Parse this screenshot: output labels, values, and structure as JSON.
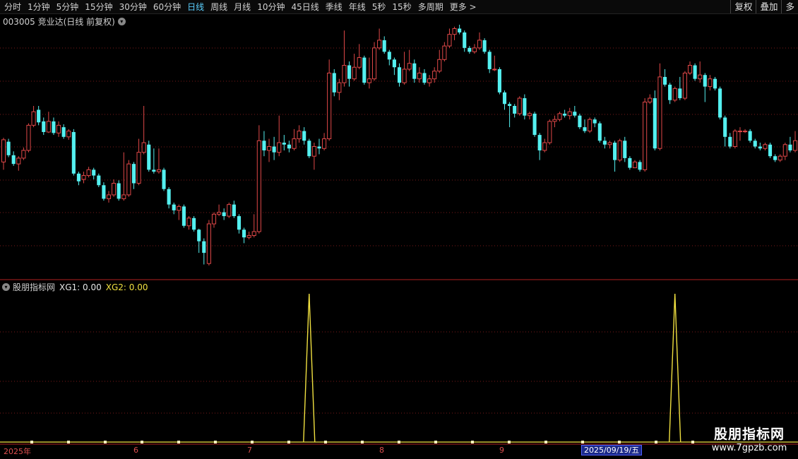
{
  "toolbar": {
    "periods": [
      "分时",
      "1分钟",
      "5分钟",
      "15分钟",
      "30分钟",
      "60分钟",
      "日线",
      "周线",
      "月线",
      "10分钟",
      "45日线",
      "季线",
      "年线",
      "5秒",
      "15秒",
      "多周期",
      "更多 >"
    ],
    "active": "日线",
    "right_buttons": [
      "复权",
      "叠加",
      "多"
    ]
  },
  "main_panel": {
    "title": "003005 竞业达(日线 前复权)"
  },
  "indicator_panel": {
    "name": "股朋指标网",
    "xg1_label": "XG1:",
    "xg1_value": "0.00",
    "xg2_label": "XG2:",
    "xg2_value": "0.00"
  },
  "date_axis": {
    "labels": [
      "2025年",
      "6",
      "7",
      "8",
      "9"
    ],
    "selected_date": "2025/09/19/五"
  },
  "watermark": {
    "title": "股朋指标网",
    "url": "www.7gpzb.com"
  },
  "colors": {
    "up": "#e04848",
    "down": "#54f0f0",
    "signal": "#f0e040",
    "grid": "#7a1a1a"
  },
  "chart_data": {
    "type": "candlestick",
    "candles": [
      [
        0.47,
        0.585,
        0.595,
        0.43
      ],
      [
        0.575,
        0.505,
        0.59,
        0.495
      ],
      [
        0.505,
        0.46,
        0.525,
        0.45
      ],
      [
        0.46,
        0.49,
        0.5,
        0.425
      ],
      [
        0.49,
        0.53,
        0.545,
        0.48
      ],
      [
        0.53,
        0.66,
        0.67,
        0.52
      ],
      [
        0.66,
        0.73,
        0.76,
        0.65
      ],
      [
        0.74,
        0.675,
        0.76,
        0.66
      ],
      [
        0.68,
        0.625,
        0.7,
        0.61
      ],
      [
        0.625,
        0.68,
        0.73,
        0.62
      ],
      [
        0.68,
        0.62,
        0.7,
        0.61
      ],
      [
        0.62,
        0.66,
        0.68,
        0.6
      ],
      [
        0.65,
        0.6,
        0.665,
        0.59
      ],
      [
        0.6,
        0.63,
        0.64,
        0.585
      ],
      [
        0.625,
        0.41,
        0.64,
        0.4
      ],
      [
        0.41,
        0.37,
        0.42,
        0.35
      ],
      [
        0.38,
        0.4,
        0.42,
        0.36
      ],
      [
        0.4,
        0.43,
        0.445,
        0.39
      ],
      [
        0.43,
        0.4,
        0.44,
        0.38
      ],
      [
        0.4,
        0.35,
        0.41,
        0.34
      ],
      [
        0.35,
        0.28,
        0.365,
        0.27
      ],
      [
        0.28,
        0.3,
        0.32,
        0.26
      ],
      [
        0.3,
        0.36,
        0.38,
        0.29
      ],
      [
        0.36,
        0.28,
        0.375,
        0.27
      ],
      [
        0.28,
        0.3,
        0.52,
        0.27
      ],
      [
        0.3,
        0.46,
        0.48,
        0.29
      ],
      [
        0.46,
        0.36,
        0.47,
        0.33
      ],
      [
        0.36,
        0.52,
        0.59,
        0.35
      ],
      [
        0.52,
        0.57,
        0.76,
        0.51
      ],
      [
        0.56,
        0.43,
        0.58,
        0.42
      ],
      [
        0.43,
        0.42,
        0.54,
        0.41
      ],
      [
        0.42,
        0.43,
        0.54,
        0.41
      ],
      [
        0.43,
        0.33,
        0.44,
        0.32
      ],
      [
        0.33,
        0.25,
        0.34,
        0.23
      ],
      [
        0.25,
        0.22,
        0.26,
        0.2
      ],
      [
        0.22,
        0.24,
        0.25,
        0.17
      ],
      [
        0.24,
        0.14,
        0.25,
        0.13
      ],
      [
        0.14,
        0.18,
        0.19,
        0.12
      ],
      [
        0.18,
        0.12,
        0.19,
        0.11
      ],
      [
        0.12,
        0.06,
        0.125,
        0.0
      ],
      [
        0.06,
        0.0,
        0.075,
        -0.06
      ],
      [
        -0.055,
        0.15,
        0.17,
        -0.065
      ],
      [
        0.15,
        0.2,
        0.21,
        0.13
      ],
      [
        0.2,
        0.21,
        0.25,
        0.19
      ],
      [
        0.21,
        0.19,
        0.23,
        0.17
      ],
      [
        0.19,
        0.25,
        0.26,
        0.18
      ],
      [
        0.25,
        0.19,
        0.27,
        0.18
      ],
      [
        0.19,
        0.12,
        0.2,
        0.1
      ],
      [
        0.12,
        0.08,
        0.13,
        0.05
      ],
      [
        0.08,
        0.09,
        0.11,
        0.07
      ],
      [
        0.09,
        0.11,
        0.2,
        0.08
      ],
      [
        0.11,
        0.58,
        0.66,
        0.1
      ],
      [
        0.58,
        0.53,
        0.63,
        0.5
      ],
      [
        0.53,
        0.55,
        0.59,
        0.47
      ],
      [
        0.55,
        0.52,
        0.6,
        0.48
      ],
      [
        0.52,
        0.57,
        0.71,
        0.5
      ],
      [
        0.57,
        0.56,
        0.61,
        0.53
      ],
      [
        0.56,
        0.54,
        0.58,
        0.52
      ],
      [
        0.54,
        0.59,
        0.64,
        0.53
      ],
      [
        0.59,
        0.63,
        0.66,
        0.57
      ],
      [
        0.63,
        0.58,
        0.65,
        0.56
      ],
      [
        0.58,
        0.5,
        0.59,
        0.49
      ],
      [
        0.5,
        0.55,
        0.57,
        0.43
      ],
      [
        0.55,
        0.54,
        0.59,
        0.51
      ],
      [
        0.54,
        0.59,
        0.62,
        0.53
      ],
      [
        0.59,
        0.93,
        1.0,
        0.58
      ],
      [
        0.93,
        0.83,
        0.95,
        0.81
      ],
      [
        0.83,
        0.88,
        0.9,
        0.79
      ],
      [
        0.88,
        0.97,
        1.15,
        0.86
      ],
      [
        0.97,
        0.9,
        0.99,
        0.86
      ],
      [
        0.9,
        0.96,
        1.03,
        0.89
      ],
      [
        0.96,
        1.01,
        1.08,
        0.95
      ],
      [
        1.01,
        0.88,
        1.02,
        0.87
      ],
      [
        0.88,
        0.9,
        1.01,
        0.85
      ],
      [
        0.9,
        1.06,
        1.09,
        0.89
      ],
      [
        1.06,
        1.1,
        1.16,
        1.05
      ],
      [
        1.1,
        1.04,
        1.12,
        1.03
      ],
      [
        1.04,
        1.0,
        1.05,
        0.97
      ],
      [
        1.0,
        0.96,
        1.01,
        0.92
      ],
      [
        0.96,
        0.88,
        0.98,
        0.86
      ],
      [
        0.88,
        0.95,
        1.04,
        0.87
      ],
      [
        0.95,
        0.98,
        1.05,
        0.94
      ],
      [
        0.98,
        0.9,
        1.0,
        0.88
      ],
      [
        0.9,
        0.93,
        0.96,
        0.88
      ],
      [
        0.93,
        0.88,
        0.95,
        0.87
      ],
      [
        0.88,
        0.9,
        0.92,
        0.86
      ],
      [
        0.9,
        0.94,
        0.96,
        0.88
      ],
      [
        0.94,
        1.0,
        1.05,
        0.93
      ],
      [
        1.0,
        1.07,
        1.09,
        0.99
      ],
      [
        1.07,
        1.13,
        1.16,
        1.06
      ],
      [
        1.13,
        1.16,
        1.17,
        1.1
      ],
      [
        1.16,
        1.14,
        1.18,
        1.13
      ],
      [
        1.14,
        1.06,
        1.15,
        1.04
      ],
      [
        1.06,
        1.04,
        1.07,
        1.03
      ],
      [
        1.04,
        1.06,
        1.08,
        1.03
      ],
      [
        1.06,
        1.1,
        1.14,
        1.05
      ],
      [
        1.1,
        1.04,
        1.11,
        1.03
      ],
      [
        1.04,
        0.95,
        1.05,
        0.93
      ],
      [
        0.95,
        0.95,
        1.02,
        0.94
      ],
      [
        0.95,
        0.83,
        0.96,
        0.82
      ],
      [
        0.83,
        0.77,
        0.84,
        0.74
      ],
      [
        0.77,
        0.76,
        0.78,
        0.65
      ],
      [
        0.76,
        0.72,
        0.77,
        0.7
      ],
      [
        0.72,
        0.8,
        0.81,
        0.71
      ],
      [
        0.8,
        0.71,
        0.82,
        0.69
      ],
      [
        0.71,
        0.72,
        0.73,
        0.69
      ],
      [
        0.72,
        0.61,
        0.73,
        0.6
      ],
      [
        0.61,
        0.53,
        0.62,
        0.48
      ],
      [
        0.53,
        0.57,
        0.59,
        0.52
      ],
      [
        0.57,
        0.68,
        0.69,
        0.56
      ],
      [
        0.68,
        0.69,
        0.71,
        0.65
      ],
      [
        0.69,
        0.72,
        0.73,
        0.68
      ],
      [
        0.72,
        0.71,
        0.74,
        0.7
      ],
      [
        0.71,
        0.73,
        0.75,
        0.69
      ],
      [
        0.73,
        0.71,
        0.76,
        0.7
      ],
      [
        0.71,
        0.65,
        0.72,
        0.64
      ],
      [
        0.65,
        0.63,
        0.69,
        0.62
      ],
      [
        0.63,
        0.69,
        0.7,
        0.62
      ],
      [
        0.69,
        0.67,
        0.7,
        0.65
      ],
      [
        0.67,
        0.58,
        0.68,
        0.57
      ],
      [
        0.58,
        0.56,
        0.6,
        0.54
      ],
      [
        0.56,
        0.57,
        0.58,
        0.54
      ],
      [
        0.57,
        0.48,
        0.58,
        0.42
      ],
      [
        0.48,
        0.58,
        0.59,
        0.47
      ],
      [
        0.58,
        0.49,
        0.6,
        0.47
      ],
      [
        0.49,
        0.44,
        0.5,
        0.43
      ],
      [
        0.44,
        0.47,
        0.48,
        0.44
      ],
      [
        0.47,
        0.43,
        0.48,
        0.42
      ],
      [
        0.43,
        0.78,
        0.8,
        0.42
      ],
      [
        0.78,
        0.8,
        0.82,
        0.77
      ],
      [
        0.8,
        0.54,
        0.84,
        0.53
      ],
      [
        0.54,
        0.91,
        0.98,
        0.53
      ],
      [
        0.91,
        0.87,
        0.95,
        0.86
      ],
      [
        0.87,
        0.79,
        0.88,
        0.77
      ],
      [
        0.79,
        0.85,
        0.86,
        0.78
      ],
      [
        0.85,
        0.8,
        0.91,
        0.79
      ],
      [
        0.8,
        0.93,
        0.94,
        0.79
      ],
      [
        0.93,
        0.97,
        0.99,
        0.92
      ],
      [
        0.97,
        0.9,
        0.98,
        0.89
      ],
      [
        0.9,
        0.92,
        0.99,
        0.88
      ],
      [
        0.92,
        0.86,
        0.93,
        0.78
      ],
      [
        0.86,
        0.9,
        0.92,
        0.84
      ],
      [
        0.9,
        0.85,
        0.91,
        0.84
      ],
      [
        0.85,
        0.7,
        0.86,
        0.69
      ],
      [
        0.7,
        0.6,
        0.71,
        0.55
      ],
      [
        0.6,
        0.55,
        0.62,
        0.54
      ],
      [
        0.55,
        0.63,
        0.64,
        0.54
      ],
      [
        0.63,
        0.63,
        0.65,
        0.58
      ],
      [
        0.63,
        0.63,
        0.64,
        0.62
      ],
      [
        0.63,
        0.58,
        0.64,
        0.57
      ],
      [
        0.58,
        0.55,
        0.59,
        0.54
      ],
      [
        0.55,
        0.54,
        0.57,
        0.53
      ],
      [
        0.54,
        0.56,
        0.57,
        0.53
      ],
      [
        0.56,
        0.5,
        0.57,
        0.49
      ],
      [
        0.5,
        0.48,
        0.51,
        0.47
      ],
      [
        0.48,
        0.5,
        0.51,
        0.47
      ],
      [
        0.5,
        0.56,
        0.57,
        0.48
      ],
      [
        0.56,
        0.53,
        0.6,
        0.52
      ],
      [
        0.53,
        0.58,
        0.63,
        0.52
      ]
    ],
    "signal_spikes": [
      {
        "date_index": 61,
        "value": 1
      },
      {
        "date_index": 134,
        "value": 1
      }
    ],
    "xg1": "0.00",
    "xg2": "0.00",
    "grid": true
  }
}
